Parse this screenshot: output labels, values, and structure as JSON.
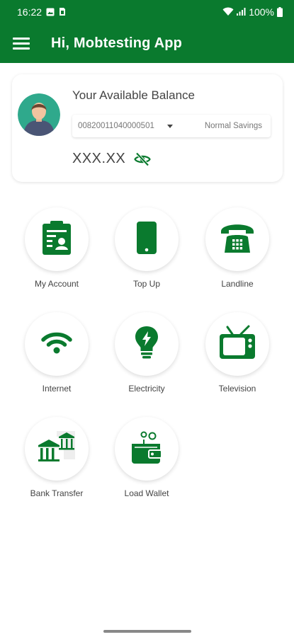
{
  "status_bar": {
    "time": "16:22",
    "battery": "100%",
    "icons": [
      "image-icon",
      "sim-icon",
      "wifi-icon",
      "signal-icon",
      "battery-icon"
    ]
  },
  "app_bar": {
    "title": "Hi, Mobtesting App",
    "menu_icon": "hamburger-menu-icon",
    "color": "#0a7a2e"
  },
  "balance_card": {
    "label": "Your Available Balance",
    "account_number": "00820011040000501",
    "account_type": "Normal Savings",
    "balance": "XXX.XX",
    "visibility_icon": "eye-off-icon"
  },
  "services": [
    {
      "label": "My Account",
      "icon": "account-clipboard-icon"
    },
    {
      "label": "Top Up",
      "icon": "phone-icon"
    },
    {
      "label": "Landline",
      "icon": "telephone-icon"
    },
    {
      "label": "Internet",
      "icon": "wifi-icon"
    },
    {
      "label": "Electricity",
      "icon": "bulb-icon"
    },
    {
      "label": "Television",
      "icon": "tv-icon"
    },
    {
      "label": "Bank Transfer",
      "icon": "bank-icon"
    },
    {
      "label": "Load Wallet",
      "icon": "wallet-icon"
    }
  ],
  "colors": {
    "brand_green": "#0a7a2e",
    "text": "#444444"
  }
}
